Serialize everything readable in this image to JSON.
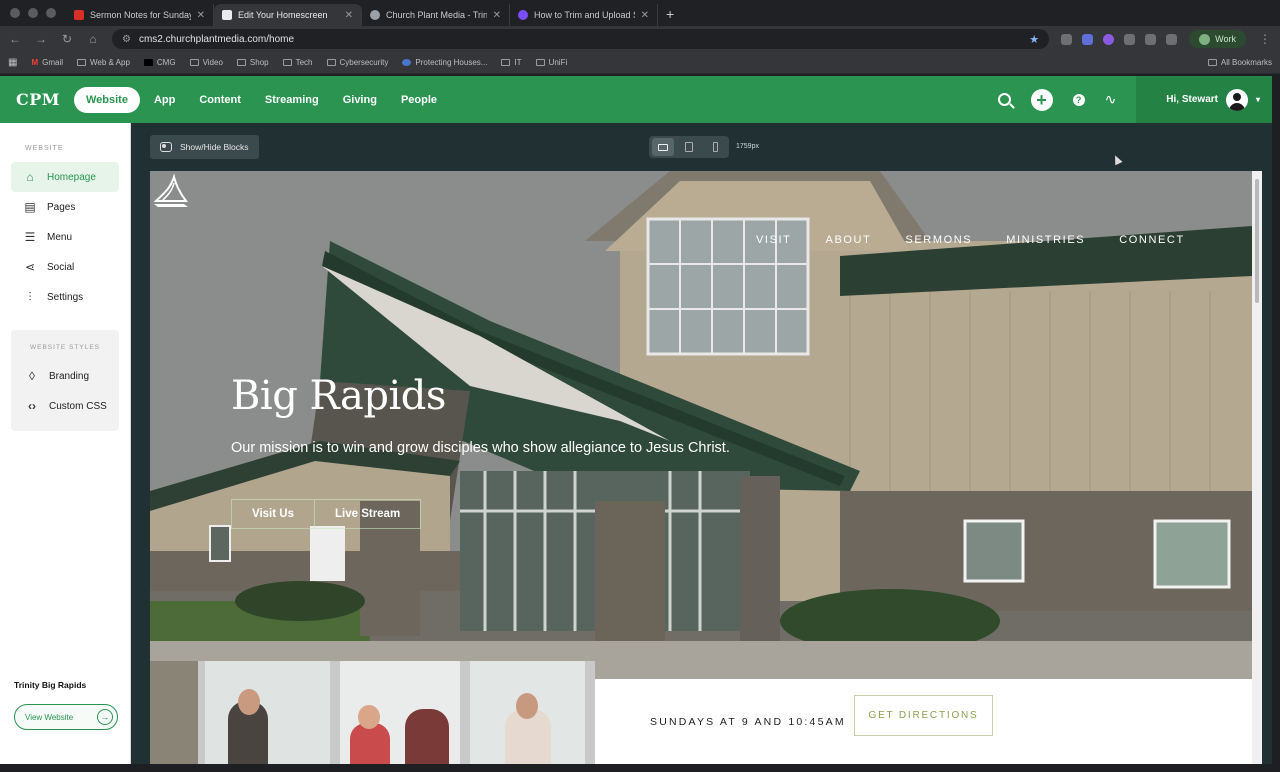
{
  "browser": {
    "tabs": [
      {
        "title": "Sermon Notes for Sunday 9.1",
        "fav_color": "#d93025",
        "active": false
      },
      {
        "title": "Edit Your Homescreen",
        "fav_color": "#e8eaed",
        "active": true
      },
      {
        "title": "Church Plant Media - Trinity B",
        "fav_color": "#9aa0a6",
        "active": false
      },
      {
        "title": "How to Trim and Upload Serm",
        "fav_color": "#7c4dff",
        "active": false
      }
    ],
    "url": "cms2.churchplantmedia.com/home",
    "profile_label": "Work",
    "bookmarks": [
      "Gmail",
      "Web & App",
      "CMG",
      "Video",
      "Shop",
      "Tech",
      "Cybersecurity",
      "Protecting Houses...",
      "IT",
      "UniFi"
    ],
    "all_bookmarks": "All Bookmarks"
  },
  "cms": {
    "logo": "CPM",
    "nav": [
      "Website",
      "App",
      "Content",
      "Streaming",
      "Giving",
      "People"
    ],
    "active_nav": "Website",
    "greeting": "Hi, Stewart",
    "brand_color": "#2a9450"
  },
  "sidebar": {
    "section_title": "WEBSITE",
    "items": [
      {
        "label": "Homepage",
        "icon": "home-icon",
        "active": true
      },
      {
        "label": "Pages",
        "icon": "pages-icon",
        "active": false
      },
      {
        "label": "Menu",
        "icon": "menu-icon",
        "active": false
      },
      {
        "label": "Social",
        "icon": "share-icon",
        "active": false
      },
      {
        "label": "Settings",
        "icon": "sliders-icon",
        "active": false
      }
    ],
    "styles_title": "WEBSITE STYLES",
    "styles_items": [
      {
        "label": "Branding",
        "icon": "droplet-icon"
      },
      {
        "label": "Custom CSS",
        "icon": "code-icon"
      }
    ],
    "site_name": "Trinity Big Rapids",
    "view_website": "View Website"
  },
  "editor": {
    "show_hide": "Show/Hide Blocks",
    "width_label": "1759px"
  },
  "site": {
    "nav": [
      "VISIT",
      "ABOUT",
      "SERMONS",
      "MINISTRIES",
      "CONNECT"
    ],
    "title": "Big Rapids",
    "subtitle": "Our mission is to win and grow disciples who show allegiance to Jesus Christ.",
    "buttons": [
      "Visit Us",
      "Live Stream"
    ],
    "service_times": "SUNDAYS AT 9 AND 10:45AM",
    "directions": "GET DIRECTIONS"
  }
}
